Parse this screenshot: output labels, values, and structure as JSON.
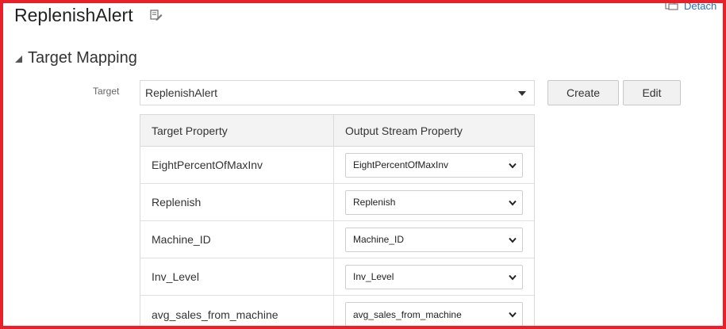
{
  "page": {
    "title": "ReplenishAlert",
    "detach_label": "Detach"
  },
  "section": {
    "title": "Target Mapping"
  },
  "target": {
    "label": "Target",
    "value": "ReplenishAlert"
  },
  "buttons": {
    "create": "Create",
    "edit": "Edit"
  },
  "table": {
    "headers": [
      "Target Property",
      "Output Stream Property"
    ],
    "rows": [
      {
        "target_property": "EightPercentOfMaxInv",
        "output_property": "EightPercentOfMaxInv"
      },
      {
        "target_property": "Replenish",
        "output_property": "Replenish"
      },
      {
        "target_property": "Machine_ID",
        "output_property": "Machine_ID"
      },
      {
        "target_property": "Inv_Level",
        "output_property": "Inv_Level"
      },
      {
        "target_property": "avg_sales_from_machine",
        "output_property": "avg_sales_from_machine"
      }
    ]
  },
  "colors": {
    "frame_border": "#e8202a",
    "link": "#2a6dbf",
    "header_bg": "#f3f3f3"
  },
  "icons": [
    "edit-pencil-icon",
    "detach-icon",
    "collapse-triangle-icon",
    "caret-down-icon",
    "chevron-down-icon"
  ]
}
